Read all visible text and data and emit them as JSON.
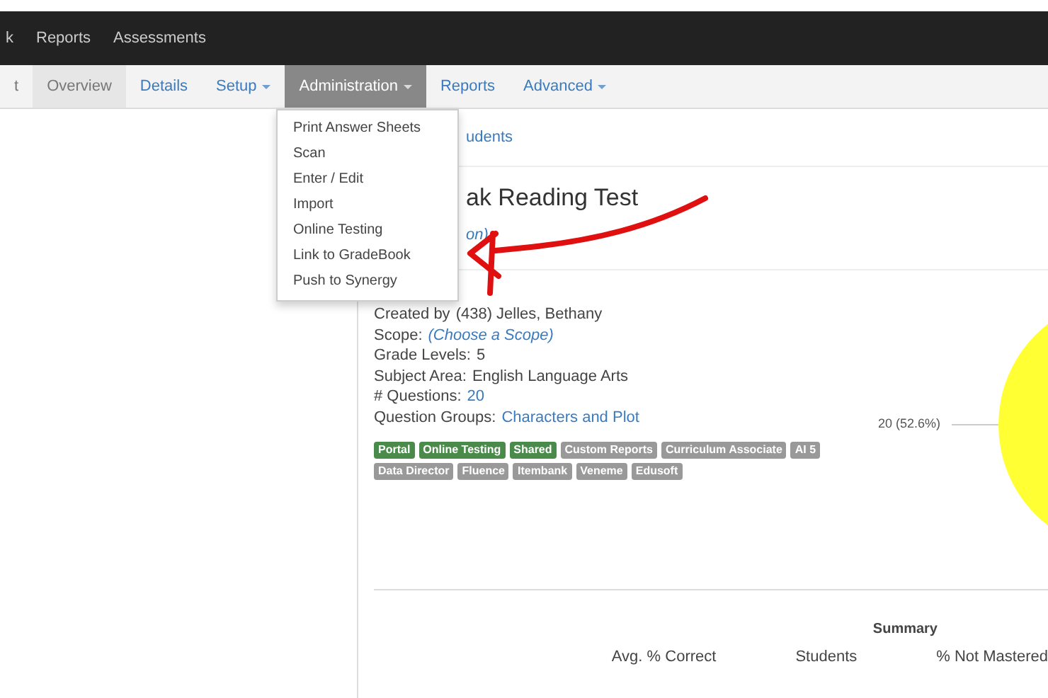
{
  "top_nav": {
    "items": [
      "k",
      "Reports",
      "Assessments"
    ]
  },
  "tabs": [
    {
      "label": "t",
      "selected": false,
      "dropdown": false
    },
    {
      "label": "Overview",
      "selected": false,
      "dropdown": false
    },
    {
      "label": "Details",
      "selected": false,
      "dropdown": false
    },
    {
      "label": "Setup",
      "selected": false,
      "dropdown": true
    },
    {
      "label": "Administration",
      "selected": true,
      "dropdown": true
    },
    {
      "label": "Reports",
      "selected": false,
      "dropdown": false
    },
    {
      "label": "Advanced",
      "selected": false,
      "dropdown": true
    }
  ],
  "menu": {
    "items": [
      "Print Answer Sheets",
      "Scan",
      "Enter / Edit",
      "Import",
      "Online Testing",
      "Link to GradeBook",
      "Push to Synergy"
    ]
  },
  "breadcrumb": "udents",
  "title": "ak Reading Test",
  "subtitle_link": "on)",
  "details": [
    {
      "label": "Created by",
      "value": "(438) Jelles, Bethany",
      "kind": "plain"
    },
    {
      "label": "Scope:",
      "value": "(Choose a Scope)",
      "kind": "italic-link"
    },
    {
      "label": "Grade Levels:",
      "value": "5",
      "kind": "plain"
    },
    {
      "label": "Subject Area:",
      "value": "English Language Arts",
      "kind": "plain"
    },
    {
      "label": "# Questions:",
      "value": "20",
      "kind": "link"
    },
    {
      "label": "Question Groups:",
      "value": "Characters and Plot",
      "kind": "link"
    }
  ],
  "tags": [
    {
      "label": "Portal",
      "color": "#4a8a4a"
    },
    {
      "label": "Online Testing",
      "color": "#4a8a4a"
    },
    {
      "label": "Shared",
      "color": "#4a8a4a"
    },
    {
      "label": "Custom Reports",
      "color": "#999999"
    },
    {
      "label": "Curriculum Associate",
      "color": "#999999"
    },
    {
      "label": "AI 5",
      "color": "#999999"
    },
    {
      "label": "Data Director",
      "color": "#999999"
    },
    {
      "label": "Fluence",
      "color": "#999999"
    },
    {
      "label": "Itembank",
      "color": "#999999"
    },
    {
      "label": "Veneme",
      "color": "#999999"
    },
    {
      "label": "Edusoft",
      "color": "#999999"
    }
  ],
  "pie": {
    "label": "20 (52.6%)"
  },
  "summary": {
    "title": "Summary",
    "columns": [
      "Avg. % Correct",
      "Students",
      "% Not Mastered"
    ]
  }
}
